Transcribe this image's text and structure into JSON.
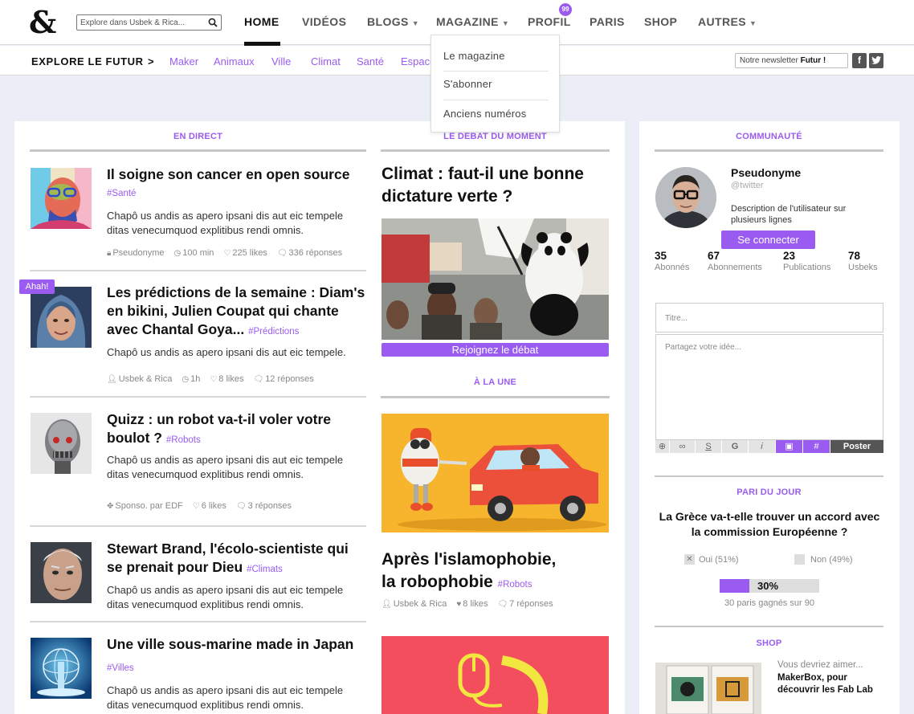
{
  "logo": "&",
  "search": {
    "placeholder": "Explore dans Usbek & Rica..."
  },
  "nav": {
    "home": "HOME",
    "videos": "VIDÉOS",
    "blogs": "BLOGS",
    "magazine": "MAGAZINE",
    "profil": "PROFIL",
    "profil_badge": "99",
    "paris": "PARIS",
    "shop": "SHOP",
    "autres": "AUTRES"
  },
  "magazine_menu": [
    "Le magazine",
    "S'abonner",
    "Anciens numéros"
  ],
  "subnav": {
    "label": "EXPLORE LE FUTUR",
    "arrow": ">",
    "items": [
      "Maker",
      "Animaux",
      "Ville",
      "Climat",
      "Santé",
      "Espace"
    ]
  },
  "newsletter": {
    "prefix": "Notre newsletter ",
    "bold": "Futur !"
  },
  "social": {
    "facebook": "f",
    "twitter": "t"
  },
  "sections": {
    "live": "EN DIRECT",
    "debate": "LE DEBAT DU MOMENT",
    "front": "À LA UNE",
    "community": "COMMUNAUTÉ",
    "bet": "PARI DU JOUR",
    "shop": "SHOP"
  },
  "live_articles": [
    {
      "title": "Il soigne son cancer en open source",
      "tag": "#Santé",
      "excerpt": "Chapô us andis as apero ipsani dis aut eic tempele ditas venecumquod explitibus rendi omnis.",
      "author": "Pseudonyme",
      "time": "100 min",
      "likes": "225 likes",
      "replies": "336 réponses"
    },
    {
      "title": "Les prédictions de la semaine : Diam's en bikini, Julien Coupat qui chante avec Chantal Goya...",
      "tag": "#Prédictions",
      "badge": "Ahah!",
      "excerpt": "Chapô us andis as apero ipsani dis aut eic tempele.",
      "author": "Usbek & Rica",
      "time": "1h",
      "likes": "8 likes",
      "replies": "12 réponses"
    },
    {
      "title": "Quizz : un robot va-t-il voler votre boulot ?",
      "tag": "#Robots",
      "excerpt": "Chapô us andis as apero ipsani dis aut eic tempele ditas venecumquod explitibus rendi omnis.",
      "author": "Sponso. par EDF",
      "likes": "6 likes",
      "replies": "3 réponses"
    },
    {
      "title": "Stewart Brand, l'écolo-scientiste qui se prenait pour Dieu",
      "tag": "#Climats",
      "excerpt": "Chapô us andis as apero ipsani dis aut eic tempele ditas venecumquod explitibus rendi omnis."
    },
    {
      "title": "Une ville sous-marine made in Japan",
      "tag": "#Villes",
      "excerpt": "Chapô us andis as apero ipsani dis aut eic tempele ditas venecumquod explitibus rendi omnis."
    }
  ],
  "debate": {
    "title": "Climat : faut-il une bonne dictature verte ?",
    "cta": "Rejoignez le débat"
  },
  "front": {
    "title_line1": "Après l'islamophobie,",
    "title_line2": "la robophobie",
    "tag": "#Robots",
    "author": "Usbek & Rica",
    "likes": "8 likes",
    "replies": "7 réponses"
  },
  "community": {
    "name": "Pseudonyme",
    "handle": "@twitter",
    "description": "Description de l'utilisateur sur plusieurs lignes",
    "connect": "Se connecter",
    "stats": [
      {
        "num": "35",
        "label": "Abonnés"
      },
      {
        "num": "67",
        "label": "Abonnements"
      },
      {
        "num": "23",
        "label": "Publications"
      },
      {
        "num": "78",
        "label": "Usbeks"
      }
    ],
    "title_placeholder": "Titre...",
    "idea_placeholder": "Partagez votre idée...",
    "toolbar": [
      "⊕",
      "∞",
      "S",
      "G",
      "i",
      "▣",
      "#"
    ],
    "post": "Poster"
  },
  "bet": {
    "question": "La Grèce va-t-elle trouver un accord avec la commission Européenne ?",
    "yes": "Oui (51%)",
    "no": "Non (49%)",
    "yes_mark": "✕",
    "progress_pct": 30,
    "progress_label": "30%",
    "sub": "30 paris gagnés sur 90"
  },
  "shop": {
    "intro": "Vous devriez aimer...",
    "product": "MakerBox, pour découvrir les Fab Lab"
  },
  "colors": {
    "accent": "#9A5CF0",
    "background": "#ECEEF7"
  }
}
